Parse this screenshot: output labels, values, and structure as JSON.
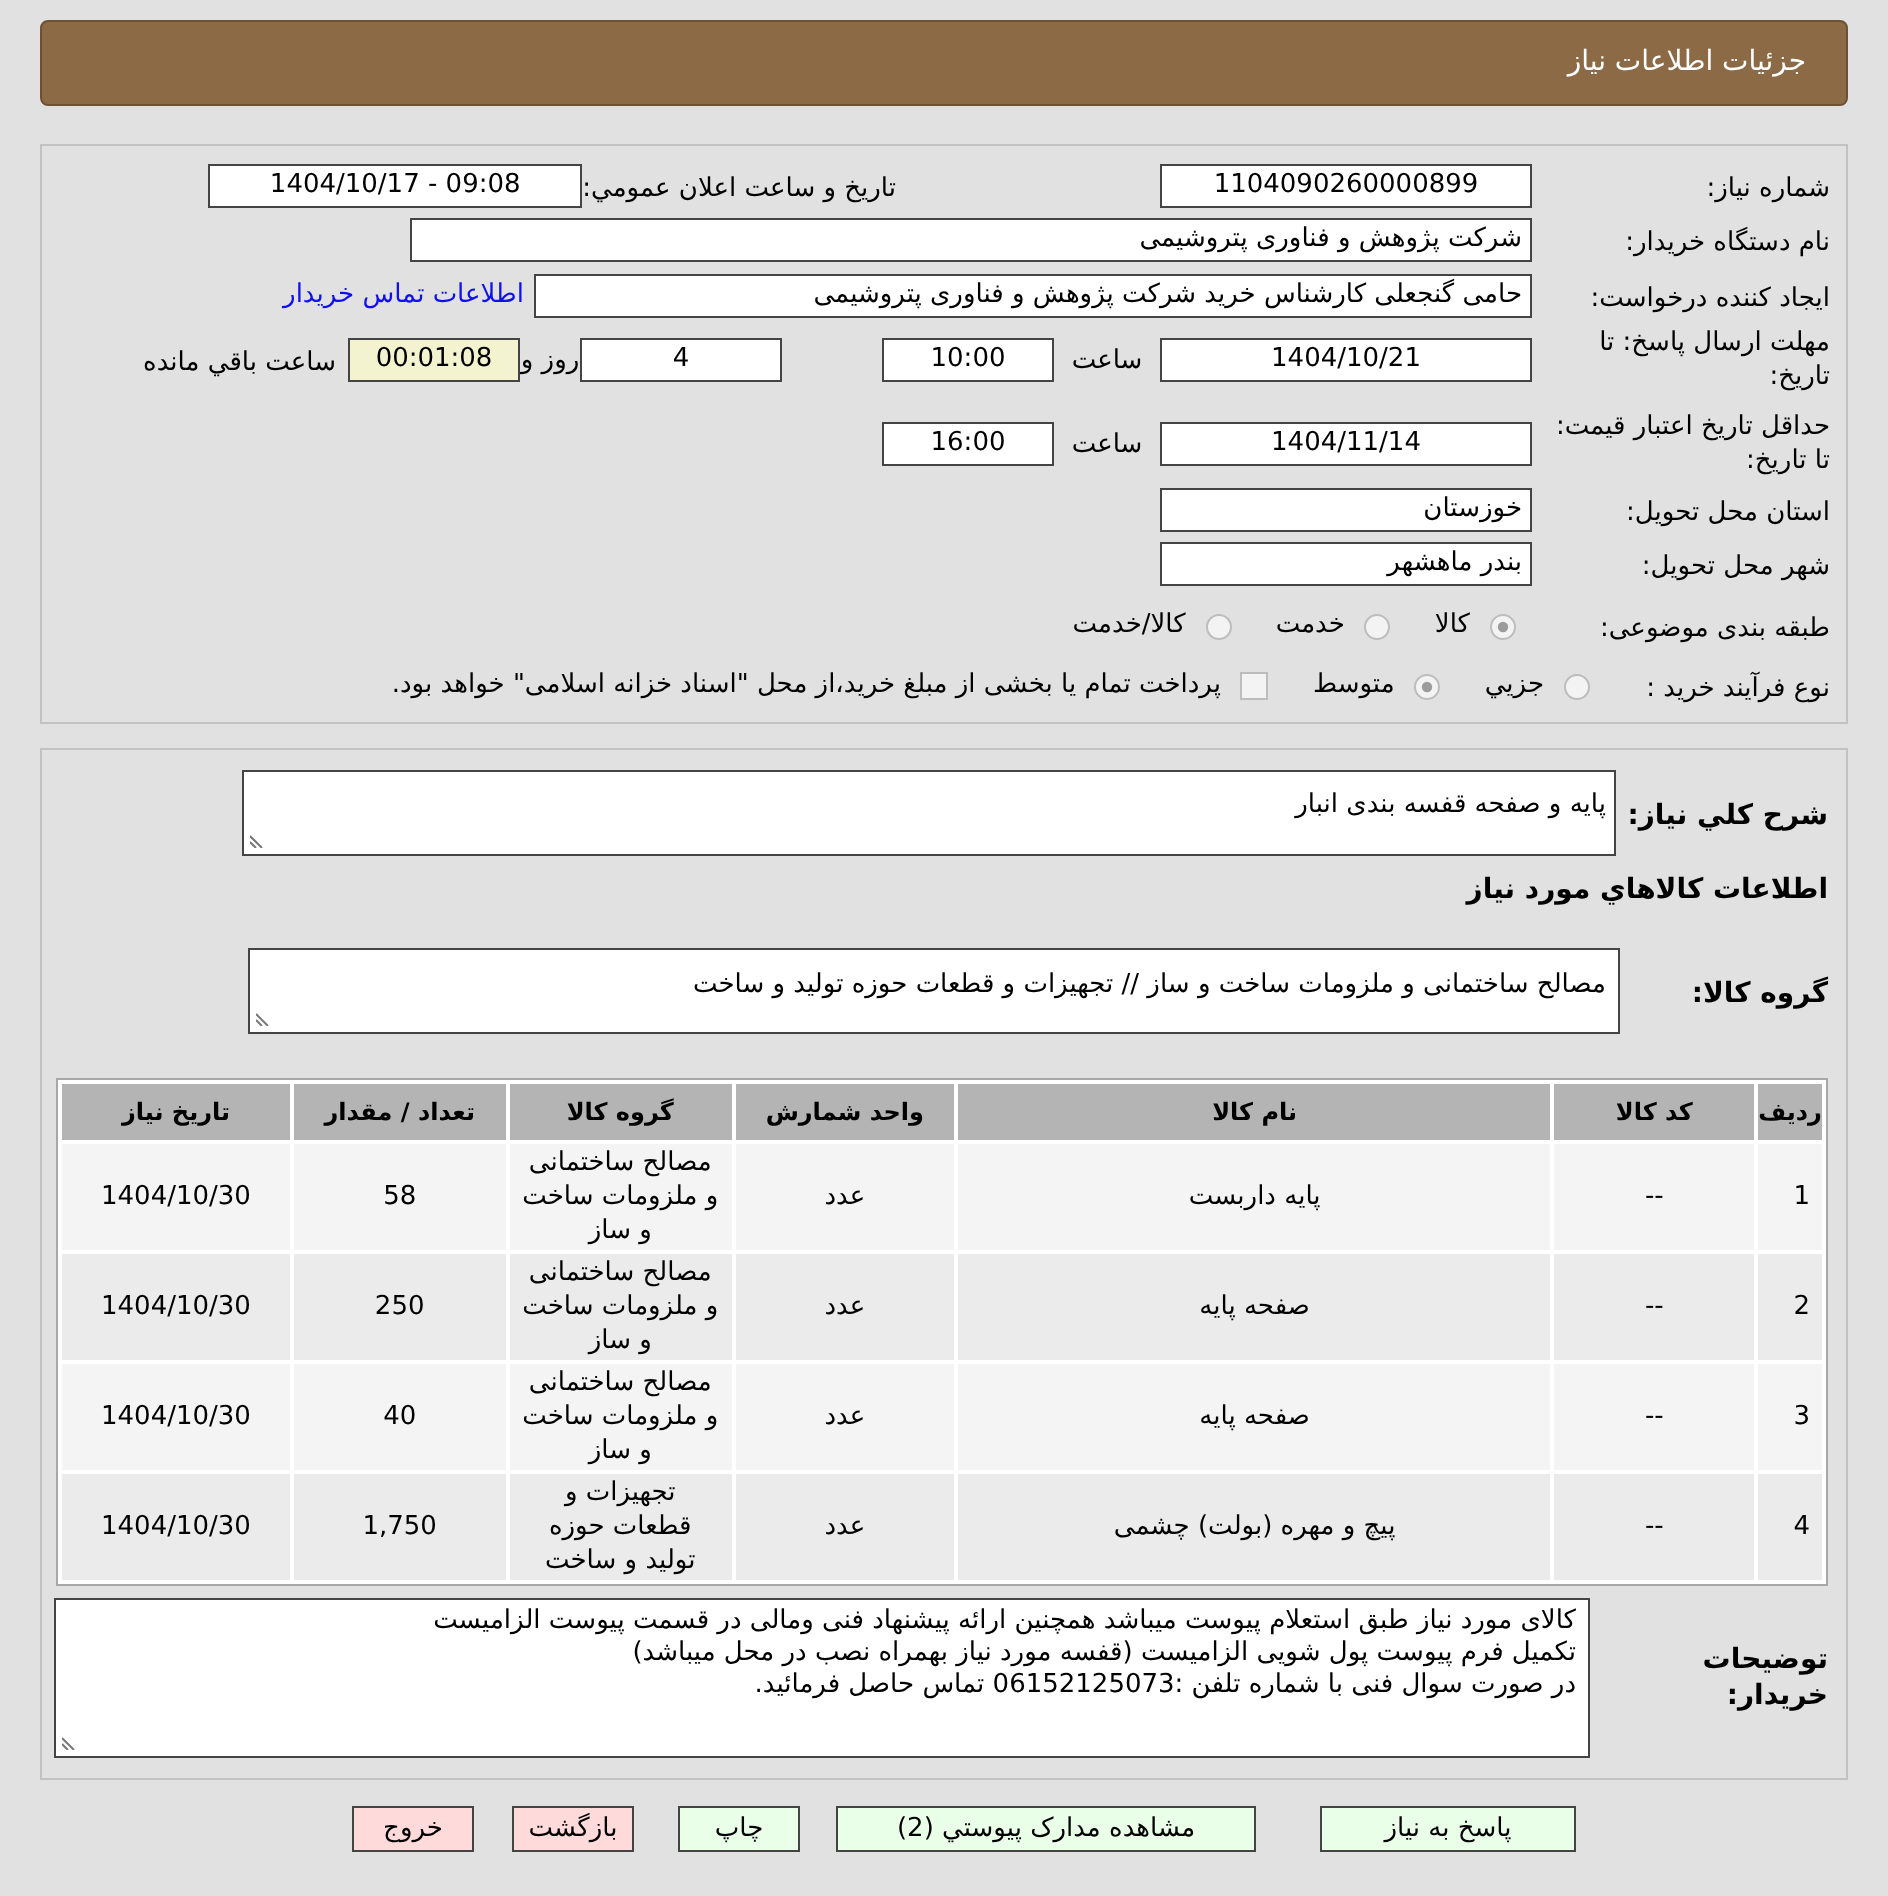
{
  "header": {
    "title": "جزئیات اطلاعات نیاز"
  },
  "details": {
    "need_number": {
      "label": "شماره نیاز:",
      "value": "1104090260000899"
    },
    "announce_datetime": {
      "label": "تاریخ و ساعت اعلان عمومي:",
      "value": "1404/10/17 - 09:08"
    },
    "buyer_org": {
      "label": "نام دستگاه خریدار:",
      "value": "شرکت پژوهش و فناوری پتروشیمی"
    },
    "requester": {
      "label": "ایجاد کننده درخواست:",
      "value": "حامی گنجعلی کارشناس خرید شرکت پژوهش و فناوری پتروشیمی",
      "link": "اطلاعات تماس خریدار"
    },
    "response_deadline": {
      "label": "مهلت ارسال پاسخ: تا تاریخ:",
      "date": "1404/10/21",
      "time_label": "ساعت",
      "time": "10:00",
      "days": "4",
      "days_label": "روز و",
      "remaining": "00:01:08",
      "remaining_label": "ساعت باقي مانده"
    },
    "price_validity": {
      "label": "حداقل تاریخ اعتبار قیمت: تا تاریخ:",
      "date": "1404/11/14",
      "time_label": "ساعت",
      "time": "16:00"
    },
    "province": {
      "label": "استان محل تحویل:",
      "value": "خوزستان"
    },
    "city": {
      "label": "شهر محل تحویل:",
      "value": "بندر ماهشهر"
    },
    "category": {
      "label": "طبقه بندی موضوعی:",
      "options": [
        {
          "label": "کالا",
          "selected": true
        },
        {
          "label": "خدمت",
          "selected": false
        },
        {
          "label": "کالا/خدمت",
          "selected": false
        }
      ]
    },
    "purchase_type": {
      "label": "نوع فرآیند خرید :",
      "options": [
        {
          "label": "جزيي",
          "selected": false
        },
        {
          "label": "متوسط",
          "selected": true
        }
      ],
      "treasury": {
        "label": "پرداخت تمام یا بخشی از مبلغ خرید،از محل \"اسناد خزانه اسلامی\" خواهد بود.",
        "checked": false
      }
    }
  },
  "description": {
    "label": "شرح کلي نیاز:",
    "value": "پایه و صفحه قفسه بندی انبار"
  },
  "goods_title": "اطلاعات کالاهاي مورد نیاز",
  "goods_group": {
    "label": "گروه کالا:",
    "value": "مصالح ساختمانی و ملزومات ساخت و ساز // تجهیزات و قطعات حوزه تولید و ساخت"
  },
  "table": {
    "columns": [
      "ردیف",
      "کد کالا",
      "نام کالا",
      "واحد شمارش",
      "گروه کالا",
      "تعداد / مقدار",
      "تاریخ نیاز"
    ],
    "rows": [
      [
        "1",
        "--",
        "پایه داربست",
        "عدد",
        "مصالح ساختمانی و ملزومات ساخت و ساز",
        "58",
        "1404/10/30"
      ],
      [
        "2",
        "--",
        "صفحه پایه",
        "عدد",
        "مصالح ساختمانی و ملزومات ساخت و ساز",
        "250",
        "1404/10/30"
      ],
      [
        "3",
        "--",
        "صفحه پایه",
        "عدد",
        "مصالح ساختمانی و ملزومات ساخت و ساز",
        "40",
        "1404/10/30"
      ],
      [
        "4",
        "--",
        "پیچ و مهره (بولت) چشمی",
        "عدد",
        "تجهیزات و قطعات حوزه تولید و ساخت",
        "1,750",
        "1404/10/30"
      ]
    ]
  },
  "buyer_notes": {
    "label": "توضیحات خریدار:",
    "lines": [
      "کالای مورد نیاز طبق استعلام پیوست میباشد همچنین ارائه پیشنهاد فنی ومالی در قسمت پیوست الزامیست",
      "تکمیل فرم پیوست پول شویی الزامیست (قفسه مورد نیاز بهمراه نصب در محل میباشد)",
      "در صورت سوال فنی با شماره تلفن :06152125073 تماس حاصل فرمائید."
    ]
  },
  "buttons": [
    {
      "label": "پاسخ به نیاز",
      "kind": "primary"
    },
    {
      "label": "مشاهده مدارک پیوستي (2)",
      "kind": "primary"
    },
    {
      "label": "چاپ",
      "kind": "primary"
    },
    {
      "label": "بازگشت",
      "kind": "danger"
    },
    {
      "label": "خروج",
      "kind": "danger"
    }
  ]
}
